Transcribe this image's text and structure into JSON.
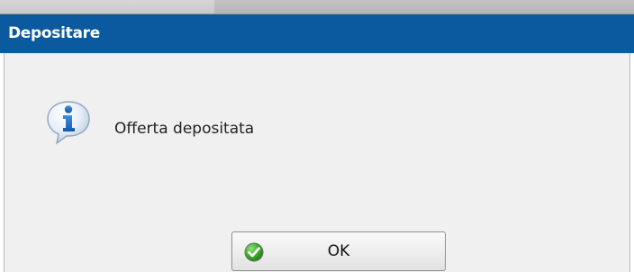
{
  "dialog": {
    "title": "Depositare",
    "message": "Offerta depositata",
    "message_icon": "info-icon",
    "ok_button": {
      "label": "OK",
      "icon": "check-icon"
    }
  },
  "colors": {
    "titlebar": "#0b5aa0",
    "title_text": "#ffffff",
    "dialog_background": "#f0f0f0",
    "check_green": "#2e9e1c",
    "info_blue": "#1f74c8"
  }
}
